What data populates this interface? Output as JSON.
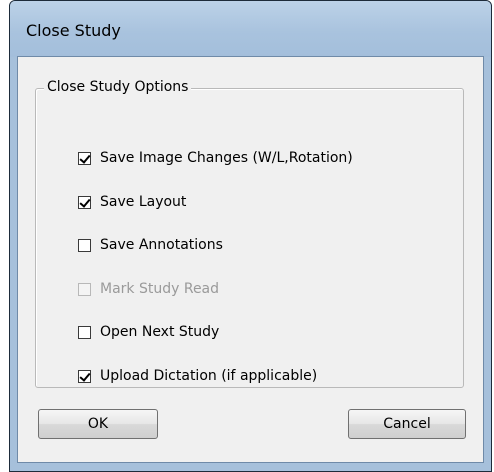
{
  "window": {
    "title": "Close Study"
  },
  "group": {
    "legend": "Close Study Options"
  },
  "options": [
    {
      "label": "Save Image Changes (W/L,Rotation)",
      "checked": true,
      "enabled": true
    },
    {
      "label": "Save Layout",
      "checked": true,
      "enabled": true
    },
    {
      "label": "Save Annotations",
      "checked": false,
      "enabled": true
    },
    {
      "label": "Mark Study Read",
      "checked": false,
      "enabled": false
    },
    {
      "label": "Open Next Study",
      "checked": false,
      "enabled": true
    },
    {
      "label": "Upload Dictation (if applicable)",
      "checked": true,
      "enabled": true
    }
  ],
  "buttons": {
    "ok": "OK",
    "cancel": "Cancel"
  },
  "colors": {
    "titlebar": "#a9c3de",
    "dialog_bg": "#f0f0f0",
    "disabled_text": "#9a9a9a"
  }
}
